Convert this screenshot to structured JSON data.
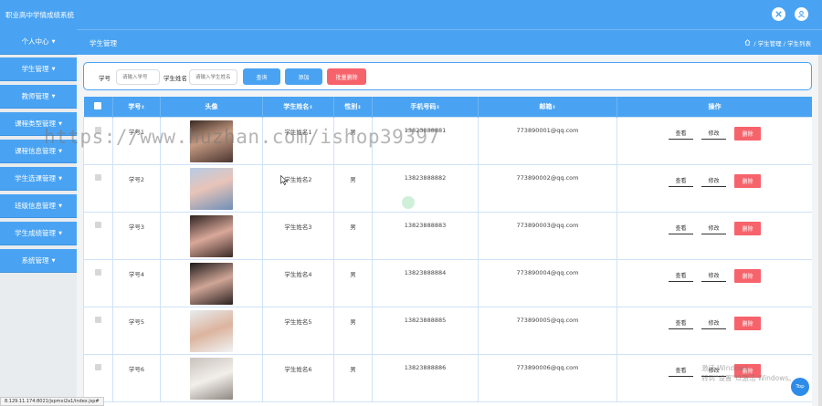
{
  "header": {
    "app_title": "职业高中学情成绩系统",
    "icons": [
      "close-circle-icon",
      "user-icon"
    ]
  },
  "sidebar": {
    "items": [
      {
        "label": "个人中心"
      },
      {
        "label": "学生管理"
      },
      {
        "label": "教师管理"
      },
      {
        "label": "课程类型管理"
      },
      {
        "label": "课程信息管理"
      },
      {
        "label": "学生选课管理"
      },
      {
        "label": "班级信息管理"
      },
      {
        "label": "学生成绩管理"
      },
      {
        "label": "系统管理"
      }
    ]
  },
  "breadcrumb": {
    "title": "学生管理",
    "path": "/ 学生管理 / 学生列表",
    "home_icon": "home-icon"
  },
  "search": {
    "student_no_label": "学号",
    "student_no_placeholder": "请输入学号",
    "student_name_label": "学生姓名",
    "student_name_placeholder": "请输入学生姓名",
    "query_button": "查询",
    "add_button": "添加",
    "batch_delete_button": "批量删除"
  },
  "table": {
    "columns": [
      "学号",
      "头像",
      "学生姓名",
      "性别",
      "手机号码",
      "邮箱",
      "操作"
    ],
    "rows": [
      {
        "student_no": "学号1",
        "name": "学生姓名1",
        "gender": "男",
        "phone": "13823888881",
        "email": "773890001@qq.com"
      },
      {
        "student_no": "学号2",
        "name": "学生姓名2",
        "gender": "男",
        "phone": "13823888882",
        "email": "773890002@qq.com"
      },
      {
        "student_no": "学号3",
        "name": "学生姓名3",
        "gender": "男",
        "phone": "13823888883",
        "email": "773890003@qq.com"
      },
      {
        "student_no": "学号4",
        "name": "学生姓名4",
        "gender": "男",
        "phone": "13823888884",
        "email": "773890004@qq.com"
      },
      {
        "student_no": "学号5",
        "name": "学生姓名5",
        "gender": "男",
        "phone": "13823888885",
        "email": "773890005@qq.com"
      },
      {
        "student_no": "学号6",
        "name": "学生姓名6",
        "gender": "男",
        "phone": "13823888886",
        "email": "773890006@qq.com"
      }
    ],
    "actions": {
      "view": "查看",
      "edit": "修改",
      "delete": "删除"
    }
  },
  "watermark": "https://www.huzhan.com/ishop39397",
  "windows_activation": {
    "line1": "激活 Windows",
    "line2": "转到\"设置\"以激活 Windows。"
  },
  "status_url": "8.129.11.174:8021/jspmxi2a1/index.jsp#",
  "top_button": "Top",
  "colors": {
    "primary": "#4aa3f2",
    "danger": "#f6636b",
    "sidebar_bg": "#e9ecef"
  }
}
